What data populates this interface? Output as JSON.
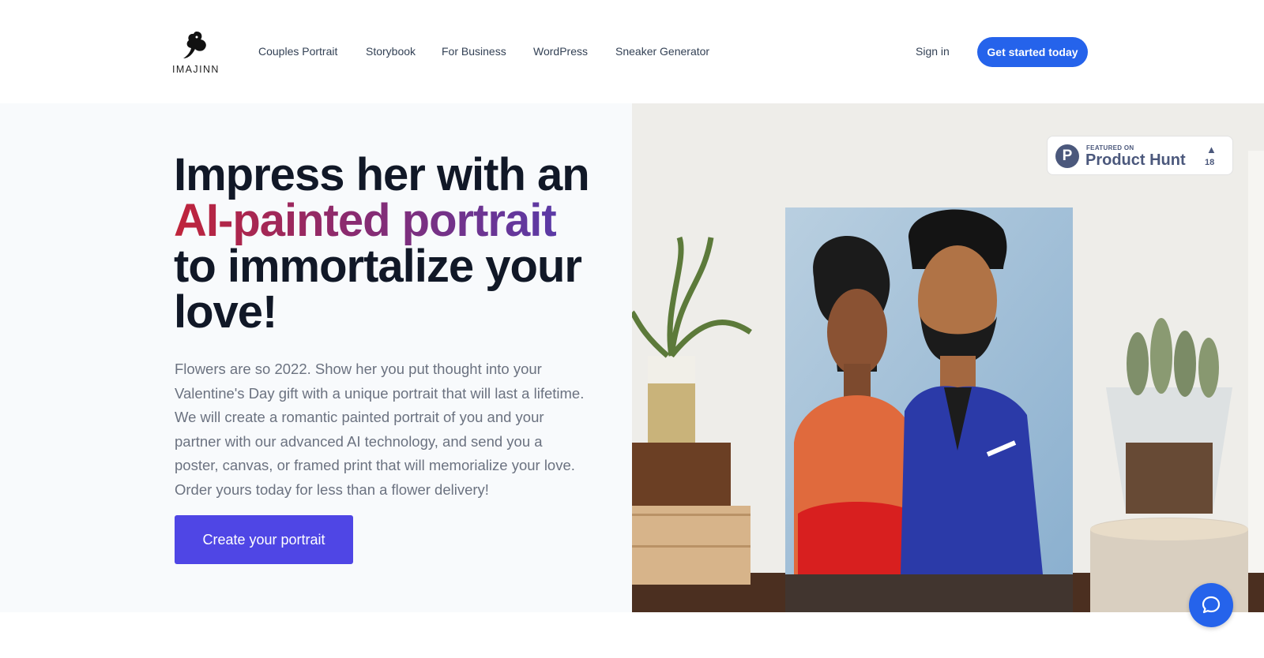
{
  "brand": {
    "name": "IMAJINN",
    "logo_icon": "genie-icon"
  },
  "nav": {
    "items": [
      {
        "label": "Couples Portrait"
      },
      {
        "label": "Storybook"
      },
      {
        "label": "For Business"
      },
      {
        "label": "WordPress"
      },
      {
        "label": "Sneaker Generator"
      }
    ],
    "sign_in": "Sign in",
    "get_started": "Get started today"
  },
  "hero": {
    "headline_line1": "Impress her with an",
    "headline_highlight": "AI-painted portrait",
    "headline_line3": "to immortalize your love!",
    "body": "Flowers are so 2022. Show her you put thought into your Valentine's Day gift with a unique portrait that will last a lifetime. We will create a romantic painted portrait of you and your partner with our advanced AI technology, and send you a poster, canvas, or framed print that will memorialize your love. Order yours today for less than a flower delivery!",
    "cta": "Create your portrait"
  },
  "product_hunt": {
    "logo_letter": "P",
    "featured": "FEATURED ON",
    "name": "Product Hunt",
    "votes": "18"
  },
  "colors": {
    "primary_blue": "#2563eb",
    "cta_indigo": "#4f46e5",
    "highlight_gradient_start": "#c0243a",
    "highlight_gradient_end": "#5b3aa6"
  },
  "icons": {
    "chat": "chat-icon",
    "upvote": "upvote-triangle-icon"
  }
}
